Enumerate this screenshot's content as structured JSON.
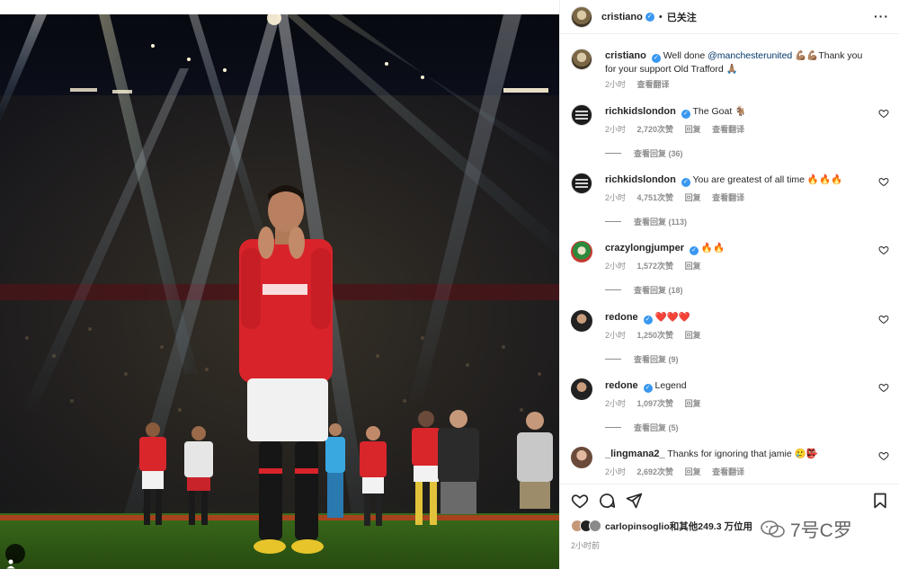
{
  "post": {
    "author": "cristiano",
    "follow_status": "已关注",
    "more_icon": "more-horizontal-icon"
  },
  "caption": {
    "user": "cristiano",
    "text_before": "Well done ",
    "mention": "@manchesterunited",
    "text_after": " 💪🏽💪🏽Thank you for your support Old Trafford 🙏🏽",
    "time": "2小时",
    "translate": "查看翻译"
  },
  "comments": [
    {
      "user": "richkidslondon",
      "verified": true,
      "text": "The Goat 🐐",
      "time": "2小时",
      "likes": "2,720次赞",
      "reply": "回复",
      "translate": "查看翻译",
      "view_replies": "查看回复 (36)"
    },
    {
      "user": "richkidslondon",
      "verified": true,
      "text": "You are greatest of all time 🔥🔥🔥",
      "time": "2小时",
      "likes": "4,751次赞",
      "reply": "回复",
      "translate": "查看翻译",
      "view_replies": "查看回复 (113)"
    },
    {
      "user": "crazylongjumper",
      "verified": true,
      "text": "🔥🔥",
      "time": "2小时",
      "likes": "1,572次赞",
      "reply": "回复",
      "translate": "",
      "view_replies": "查看回复 (18)"
    },
    {
      "user": "redone",
      "verified": true,
      "text": "❤️❤️❤️",
      "time": "2小时",
      "likes": "1,250次赞",
      "reply": "回复",
      "translate": "",
      "view_replies": "查看回复 (9)"
    },
    {
      "user": "redone",
      "verified": true,
      "text": "Legend",
      "time": "2小时",
      "likes": "1,097次赞",
      "reply": "回复",
      "translate": "",
      "view_replies": "查看回复 (5)"
    },
    {
      "user": "_lingmana2_",
      "verified": false,
      "text": "Thanks for ignoring that jamie 🥲👺",
      "time": "2小时",
      "likes": "2,692次赞",
      "reply": "回复",
      "translate": "查看翻译",
      "view_replies": ""
    }
  ],
  "likes_line": {
    "user": "carlopinsoglio",
    "rest": "和其他249.3 万位用"
  },
  "post_time": "2小时前",
  "watermark": "7号C罗",
  "icons": [
    "heart-icon",
    "comment-icon",
    "share-icon",
    "bookmark-icon",
    "user-tag-icon"
  ]
}
